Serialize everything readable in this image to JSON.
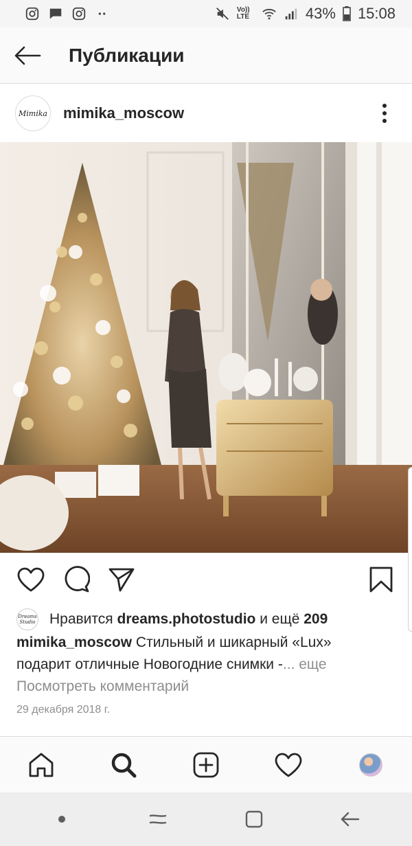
{
  "status_bar": {
    "time": "15:08",
    "battery": "43%",
    "network_label": "Vo)) LTE",
    "left_icons": [
      "instagram-icon",
      "message-icon",
      "instagram-icon",
      "more-dots-icon"
    ],
    "right_icons": [
      "mute-icon",
      "volte-icon",
      "wifi-icon",
      "signal-icon",
      "battery-icon"
    ]
  },
  "header": {
    "title": "Публикации",
    "back_icon": "back-arrow-icon"
  },
  "post": {
    "username": "mimika_moscow",
    "avatar_text": "Mimika",
    "more_icon": "vertical-dots-icon",
    "photo_icon": "photo",
    "likes": {
      "prefix": "Нравится",
      "liker": "dreams.photostudio",
      "middle": "и ещё",
      "count": "209",
      "liker_avatar_text": "Dreams Studio"
    },
    "caption": {
      "author": "mimika_moscow",
      "text": "Стильный и шикарный «Lux» подарит отличные Новогодние снимки -",
      "more": "... еще"
    },
    "view_comments": "Посмотреть комментарий",
    "date": "29 декабря 2018 г."
  },
  "actions": [
    "heart-icon",
    "comment-icon",
    "share-icon",
    "bookmark-icon"
  ],
  "bottom_nav": [
    "home-icon",
    "search-icon",
    "add-icon",
    "activity-icon",
    "profile-icon"
  ],
  "system_nav": [
    "dot-icon",
    "recents-icon",
    "home-square-icon",
    "back-icon"
  ],
  "colors": {
    "text": "#262626",
    "muted": "#8e8e8e",
    "border": "#dbdbdb",
    "header_bg": "#fafafa"
  }
}
